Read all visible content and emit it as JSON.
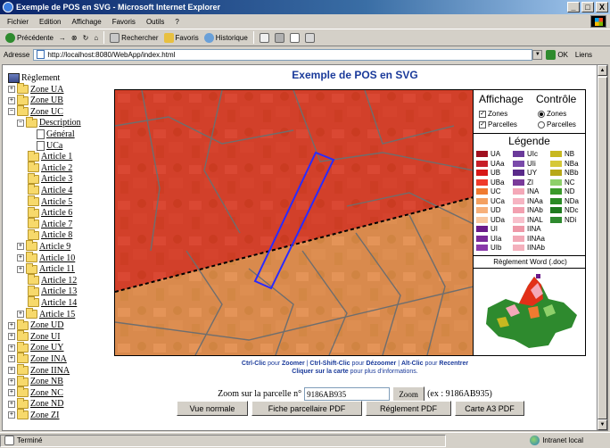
{
  "window": {
    "title": "Exemple de POS en SVG - Microsoft Internet Explorer",
    "controls": [
      "_",
      "□",
      "X"
    ]
  },
  "menu": [
    "Fichier",
    "Edition",
    "Affichage",
    "Favoris",
    "Outils",
    "?"
  ],
  "toolbar": {
    "back": "Précédente",
    "forward": "→",
    "stop": "⊗",
    "refresh": "↻",
    "home": "⌂",
    "search": "Rechercher",
    "favorites": "Favoris",
    "history": "Historique"
  },
  "address": {
    "label": "Adresse",
    "url": "http://localhost:8080/WebApp/index.html",
    "go": "OK",
    "links": "Liens"
  },
  "tree": {
    "root": "Règlement",
    "items": [
      {
        "label": "Zone UA",
        "pm": "+"
      },
      {
        "label": "Zone UB",
        "pm": "+"
      },
      {
        "label": "Zone UC",
        "pm": "−"
      },
      {
        "label": "Description",
        "pm": "−"
      },
      {
        "label": "Général"
      },
      {
        "label": "UCa"
      },
      {
        "label": "Article 1"
      },
      {
        "label": "Article 2"
      },
      {
        "label": "Article 3"
      },
      {
        "label": "Article 4"
      },
      {
        "label": "Article 5"
      },
      {
        "label": "Article 6"
      },
      {
        "label": "Article 7"
      },
      {
        "label": "Article 8"
      },
      {
        "label": "Article 9",
        "pm": "+"
      },
      {
        "label": "Article 10",
        "pm": "+"
      },
      {
        "label": "Article 11",
        "pm": "+"
      },
      {
        "label": "Article 12"
      },
      {
        "label": "Article 13"
      },
      {
        "label": "Article 14"
      },
      {
        "label": "Article 15",
        "pm": "+"
      },
      {
        "label": "Zone UD",
        "pm": "+"
      },
      {
        "label": "Zone UI",
        "pm": "+"
      },
      {
        "label": "Zone UY",
        "pm": "+"
      },
      {
        "label": "Zone INA",
        "pm": "+"
      },
      {
        "label": "Zone IINA",
        "pm": "+"
      },
      {
        "label": "Zone NB",
        "pm": "+"
      },
      {
        "label": "Zone NC",
        "pm": "+"
      },
      {
        "label": "Zone ND",
        "pm": "+"
      },
      {
        "label": "Zone ZI",
        "pm": "+"
      }
    ]
  },
  "page": {
    "title": "Exemple de POS en SVG"
  },
  "panel": {
    "affichage_title": "Affichage",
    "controle_title": "Contrôle",
    "affichage": [
      {
        "label": "Zones",
        "checked": true
      },
      {
        "label": "Parcelles",
        "checked": true
      }
    ],
    "controle": [
      {
        "label": "Zones",
        "selected": true
      },
      {
        "label": "Parcelles",
        "selected": false
      }
    ],
    "legend_title": "Légende",
    "legend": [
      {
        "label": "UA",
        "color": "#a01020"
      },
      {
        "label": "UAa",
        "color": "#c81e28"
      },
      {
        "label": "UB",
        "color": "#d81818"
      },
      {
        "label": "UBa",
        "color": "#f03a2a"
      },
      {
        "label": "UC",
        "color": "#f07a30"
      },
      {
        "label": "UCa",
        "color": "#f4a060"
      },
      {
        "label": "UD",
        "color": "#f7b07a"
      },
      {
        "label": "UDa",
        "color": "#f9c8a0"
      },
      {
        "label": "UI",
        "color": "#6a1a8a"
      },
      {
        "label": "UIa",
        "color": "#7a2a9a"
      },
      {
        "label": "UIb",
        "color": "#8a3aaa"
      },
      {
        "label": "UIc",
        "color": "#6a3a9a"
      },
      {
        "label": "UIi",
        "color": "#7a4aaa"
      },
      {
        "label": "UY",
        "color": "#5a2a8a"
      },
      {
        "label": "ZI",
        "color": "#7a3a9a"
      },
      {
        "label": "INA",
        "color": "#f4a8b8"
      },
      {
        "label": "INAa",
        "color": "#f6b4c2"
      },
      {
        "label": "INAb",
        "color": "#f2a0b0"
      },
      {
        "label": "INAL",
        "color": "#f8c0cc"
      },
      {
        "label": "IINA",
        "color": "#ee98a8"
      },
      {
        "label": "IINAa",
        "color": "#f2a8b6"
      },
      {
        "label": "IINAb",
        "color": "#f4b0bc"
      },
      {
        "label": "NB",
        "color": "#c8b820"
      },
      {
        "label": "NBa",
        "color": "#d6c838"
      },
      {
        "label": "NBb",
        "color": "#b8a818"
      },
      {
        "label": "NC",
        "color": "#8ed06a"
      },
      {
        "label": "ND",
        "color": "#3a9a2a"
      },
      {
        "label": "NDa",
        "color": "#2a8a24"
      },
      {
        "label": "NDc",
        "color": "#1e7a1e"
      },
      {
        "label": "NDi",
        "color": "#2e8a2e"
      }
    ],
    "reglement_title": "Règlement Word (.doc)"
  },
  "help": {
    "line1_a": "Ctrl-Clic",
    "line1_b": " pour ",
    "line1_c": "Zoomer",
    "line1_d": "   |   ",
    "line1_e": "Ctrl-Shift-Clic",
    "line1_f": " pour ",
    "line1_g": "Dézoomer",
    "line1_h": "   |   ",
    "line1_i": "Alt-Clic",
    "line1_j": " pour ",
    "line1_k": "Recentrer",
    "line2_a": "Cliquer sur la carte",
    "line2_b": " pour plus d'informations."
  },
  "zoom": {
    "label": "Zoom sur la parcelle n°",
    "value": "9186AB935",
    "button": "Zoom",
    "example": "(ex : 9186AB935)"
  },
  "buttons": [
    "Vue normale",
    "Fiche parcellaire PDF",
    "Réglement PDF",
    "Carte A3 PDF"
  ],
  "status": {
    "left": "Terminé",
    "zone": "Intranet local"
  }
}
